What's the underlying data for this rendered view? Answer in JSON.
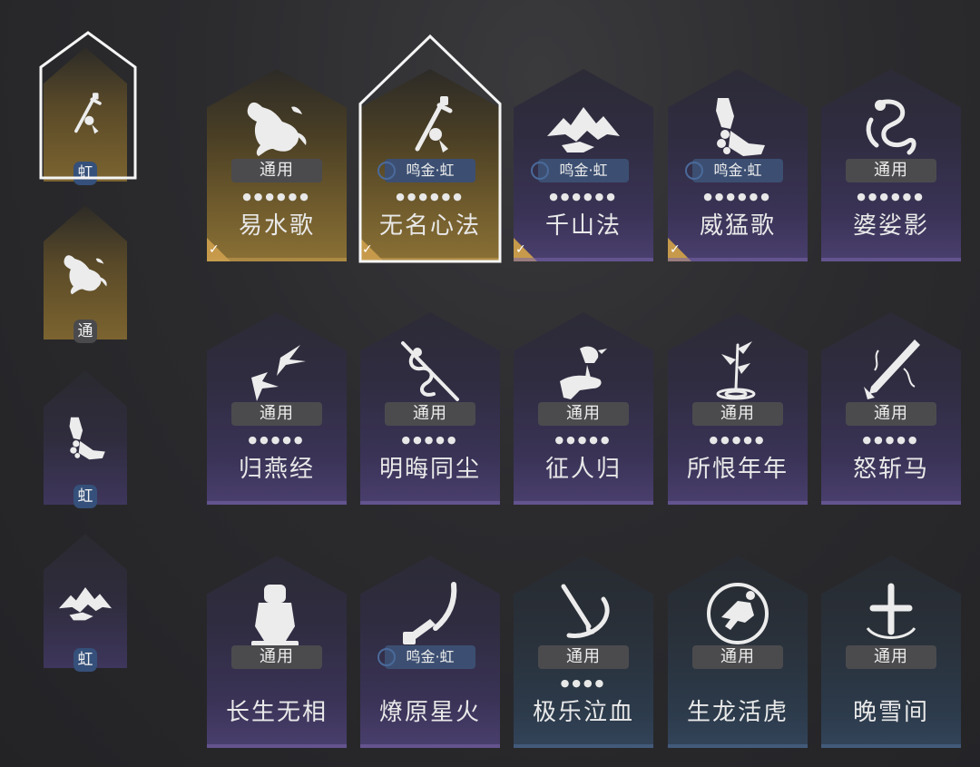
{
  "sidebar": {
    "items": [
      {
        "icon": "sword-pendant-icon",
        "badge": "虹",
        "badge_style": "blue",
        "selected": true
      },
      {
        "icon": "horse-icon",
        "badge": "通",
        "badge_style": "grey",
        "selected": false
      },
      {
        "icon": "fist-icon",
        "badge": "虹",
        "badge_style": "blue",
        "selected": false
      },
      {
        "icon": "mountain-icon",
        "badge": "虹",
        "badge_style": "blue",
        "selected": false
      }
    ]
  },
  "grid": {
    "cards": [
      {
        "title": "易水歌",
        "tag": "通用",
        "tag_style": "grey",
        "dots": "●●●●●●",
        "icon": "horse-icon",
        "theme": "gold",
        "checked": true,
        "selected": false
      },
      {
        "title": "无名心法",
        "tag": "鸣金·虹",
        "tag_style": "blue",
        "dots": "●●●●●●",
        "icon": "sword-pendant-icon",
        "theme": "gold",
        "checked": true,
        "selected": true
      },
      {
        "title": "千山法",
        "tag": "鸣金·虹",
        "tag_style": "blue",
        "dots": "●●●●●●",
        "icon": "mountain-icon",
        "theme": "purple",
        "checked": true,
        "selected": false
      },
      {
        "title": "威猛歌",
        "tag": "鸣金·虹",
        "tag_style": "blue",
        "dots": "●●●●●●",
        "icon": "fist-icon",
        "theme": "purple",
        "checked": true,
        "selected": false
      },
      {
        "title": "婆娑影",
        "tag": "通用",
        "tag_style": "grey",
        "dots": "●●●●●●",
        "icon": "dragon-icon",
        "theme": "purple",
        "checked": false,
        "selected": false
      },
      {
        "title": "归燕经",
        "tag": "通用",
        "tag_style": "grey",
        "dots": "●●●●●",
        "icon": "swallows-icon",
        "theme": "purple",
        "checked": false,
        "selected": false
      },
      {
        "title": "明晦同尘",
        "tag": "通用",
        "tag_style": "grey",
        "dots": "●●●●●",
        "icon": "snake-staff-icon",
        "theme": "purple",
        "checked": false,
        "selected": false
      },
      {
        "title": "征人归",
        "tag": "通用",
        "tag_style": "grey",
        "dots": "●●●●●",
        "icon": "bird-hand-icon",
        "theme": "purple",
        "checked": false,
        "selected": false
      },
      {
        "title": "所恨年年",
        "tag": "通用",
        "tag_style": "grey",
        "dots": "●●●●●",
        "icon": "bamboo-ripple-icon",
        "theme": "purple",
        "checked": false,
        "selected": false
      },
      {
        "title": "怒斩马",
        "tag": "通用",
        "tag_style": "grey",
        "dots": "●●●●●",
        "icon": "broken-blade-icon",
        "theme": "purple",
        "checked": false,
        "selected": false
      },
      {
        "title": "长生无相",
        "tag": "通用",
        "tag_style": "grey",
        "dots": "",
        "icon": "statue-icon",
        "theme": "purple",
        "checked": false,
        "selected": false
      },
      {
        "title": "燎原星火",
        "tag": "鸣金·虹",
        "tag_style": "blue",
        "dots": "",
        "icon": "spear-icon",
        "theme": "purple",
        "checked": false,
        "selected": false
      },
      {
        "title": "极乐泣血",
        "tag": "通用",
        "tag_style": "grey",
        "dots": "●●●●",
        "icon": "slash-icon",
        "theme": "teal",
        "checked": false,
        "selected": false
      },
      {
        "title": "生龙活虎",
        "tag": "通用",
        "tag_style": "grey",
        "dots": "",
        "icon": "leaping-figure-icon",
        "theme": "teal",
        "checked": false,
        "selected": false
      },
      {
        "title": "晚雪间",
        "tag": "通用",
        "tag_style": "grey",
        "dots": "",
        "icon": "cross-anchor-icon",
        "theme": "teal",
        "checked": false,
        "selected": false
      }
    ]
  },
  "colors": {
    "gold": "#8a7035",
    "purple": "#4a3f6e",
    "teal": "#33445a",
    "tag_blue": "#3c4f72",
    "check": "#c69a4a"
  }
}
